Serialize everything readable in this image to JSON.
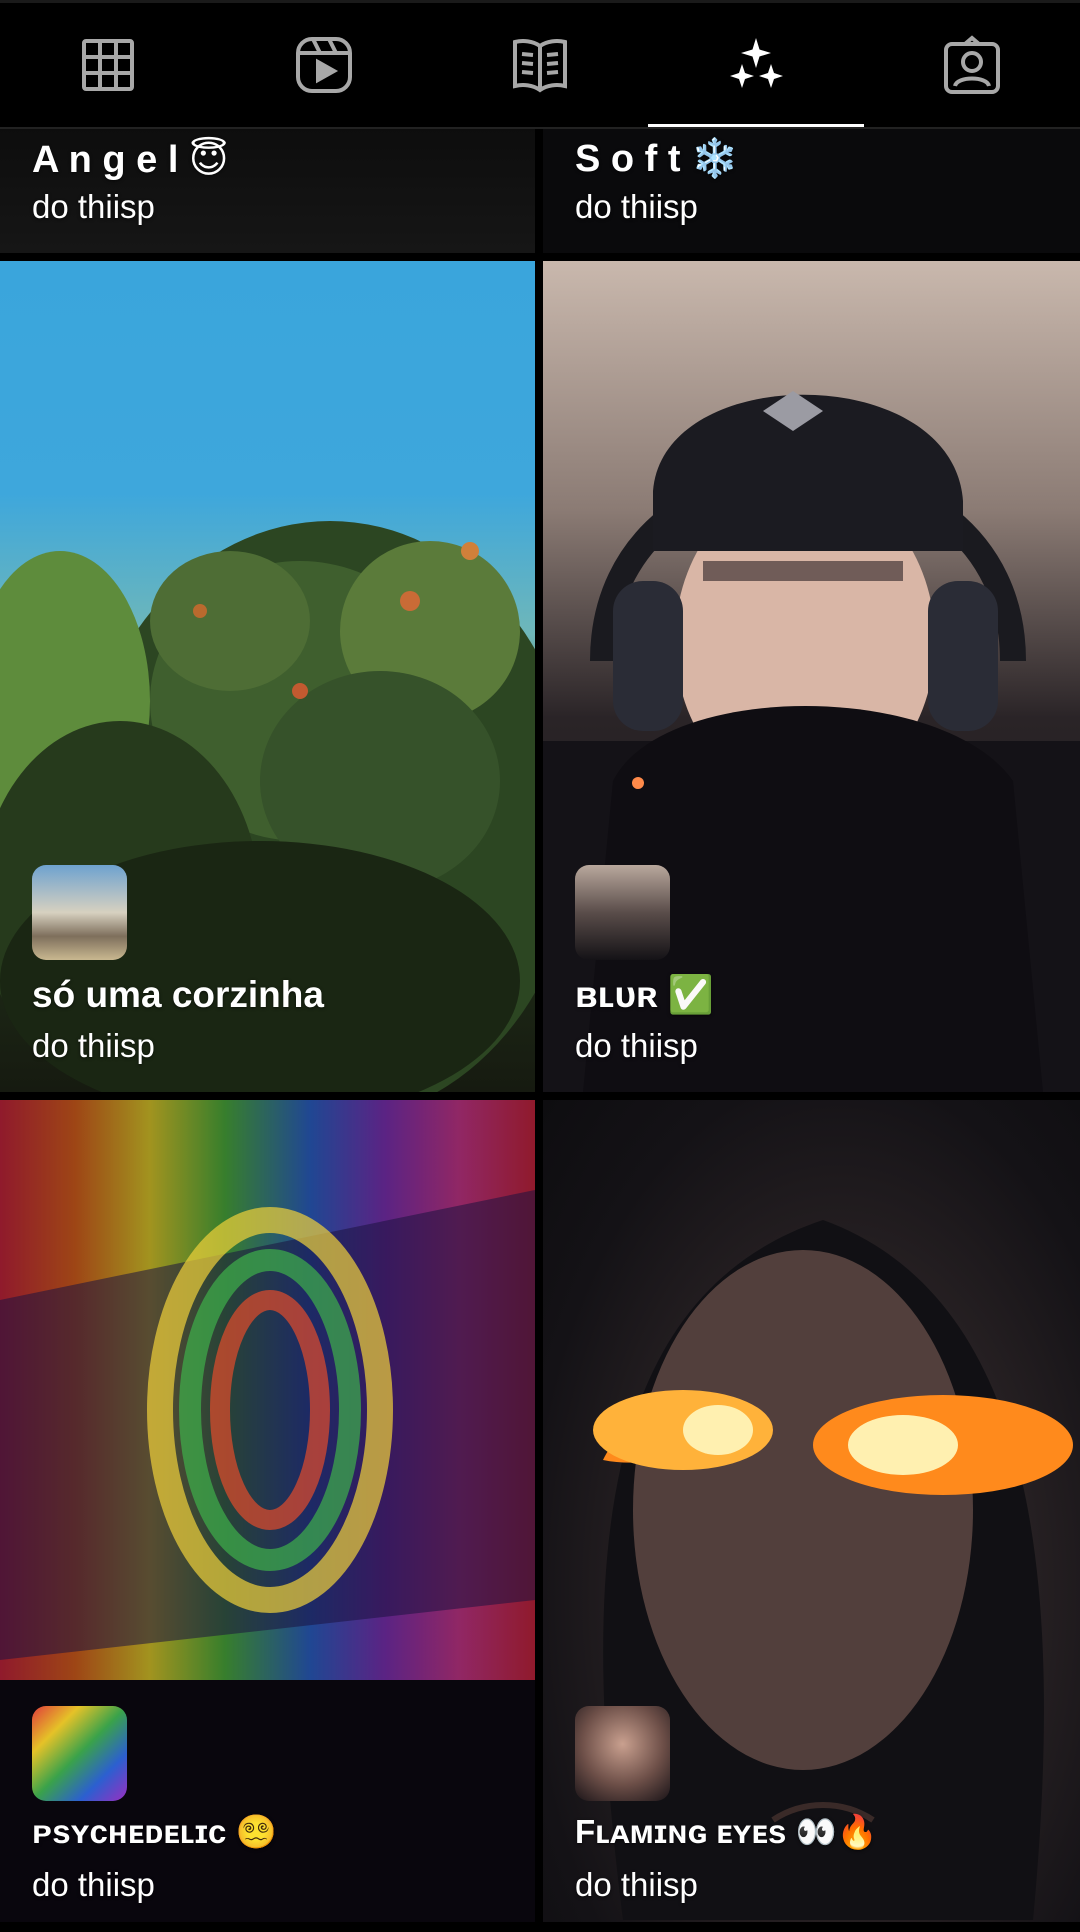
{
  "tabs": [
    {
      "name": "tab-grid",
      "icon": "grid-icon",
      "active": false
    },
    {
      "name": "tab-reels",
      "icon": "reels-play-icon",
      "active": false
    },
    {
      "name": "tab-guides",
      "icon": "guides-book-icon",
      "active": false
    },
    {
      "name": "tab-effects",
      "icon": "sparkles-icon",
      "active": true
    },
    {
      "name": "tab-tagged",
      "icon": "tagged-person-icon",
      "active": false
    }
  ],
  "effects": [
    {
      "title": "A n g e l 😇",
      "author": "do thiisp"
    },
    {
      "title": "S o f t ❄️",
      "author": "do thiisp"
    },
    {
      "title": "só uma corzinha",
      "author": "do thiisp",
      "thumb": "sunset-beach-thumbnail"
    },
    {
      "title": "ʙʟᴜʀ ✅",
      "author": "do thiisp",
      "thumb": "person-selfie-thumbnail"
    },
    {
      "title": "ᴘsʏᴄʜᴇᴅᴇʟɪᴄ 😵‍💫",
      "author": "do thiisp",
      "thumb": "rainbow-monitor-thumbnail"
    },
    {
      "title": "Fʟᴀᴍɪɴɢ ᴇʏᴇs 👀🔥",
      "author": "do thiisp",
      "thumb": "flaming-eyes-thumbnail"
    }
  ],
  "colors": {
    "background": "#000000",
    "text": "#ffffff",
    "active_indicator": "#ffffff"
  }
}
